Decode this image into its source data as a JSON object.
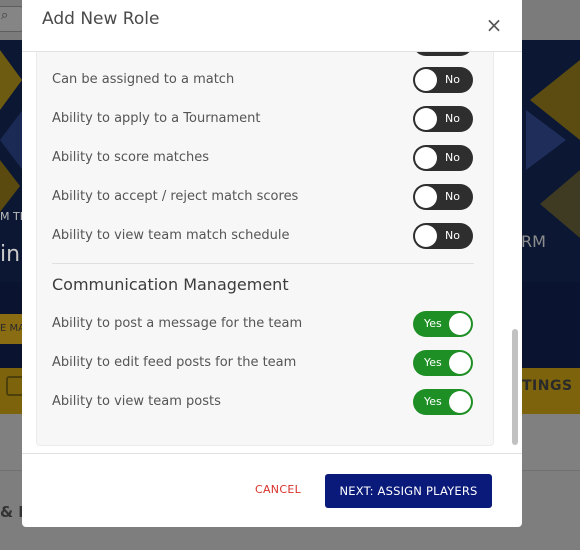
{
  "modal": {
    "title": "Add New Role",
    "close_icon": "close-icon",
    "sections": [
      {
        "title": "",
        "permissions": [
          {
            "label": "Can be assigned to a match",
            "value": "No"
          },
          {
            "label": "Ability to apply to a Tournament",
            "value": "No"
          },
          {
            "label": "Ability to score matches",
            "value": "No"
          },
          {
            "label": "Ability to accept / reject match scores",
            "value": "No"
          },
          {
            "label": "Ability to view team match schedule",
            "value": "No"
          }
        ]
      },
      {
        "title": "Communication Management",
        "permissions": [
          {
            "label": "Ability to post a message for the team",
            "value": "Yes"
          },
          {
            "label": "Ability to edit feed posts for the team",
            "value": "Yes"
          },
          {
            "label": "Ability to view team posts",
            "value": "Yes"
          }
        ]
      }
    ],
    "footer": {
      "cancel_label": "CANCEL",
      "next_label": "NEXT: ASSIGN PLAYERS"
    }
  },
  "background": {
    "banner_text_small": "M TE",
    "banner_text_big": "in",
    "banner_text_right": "RM",
    "gold_button_label": "E MA",
    "tab_right_label": "TINGS",
    "lower_text": "& F"
  },
  "colors": {
    "toggle_on": "#1e8f25",
    "toggle_off": "#2e2e2e",
    "primary_button": "#0a1a7a",
    "cancel_text": "#d9322a"
  }
}
